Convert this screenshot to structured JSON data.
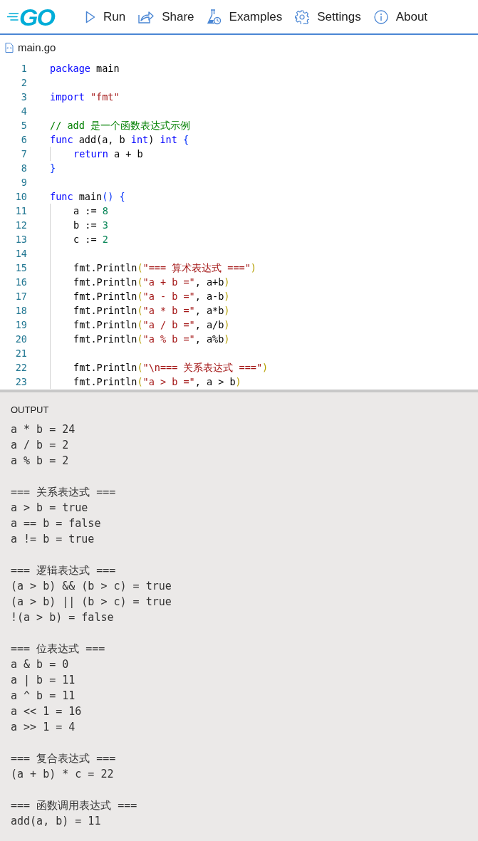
{
  "header": {
    "logo": "GO",
    "nav": [
      {
        "kind": "run",
        "label": "Run"
      },
      {
        "kind": "share",
        "label": "Share"
      },
      {
        "kind": "examples",
        "label": "Examples"
      },
      {
        "kind": "settings",
        "label": "Settings"
      },
      {
        "kind": "about",
        "label": "About"
      }
    ]
  },
  "file_tab": {
    "label": "main.go"
  },
  "editor": {
    "lines": [
      {
        "number": "1",
        "indented": false,
        "tokens": [
          {
            "kind": "keyword",
            "text": "package"
          },
          {
            "kind": "plain",
            "text": " main"
          }
        ]
      },
      {
        "number": "2",
        "indented": false
      },
      {
        "number": "3",
        "indented": false,
        "tokens": [
          {
            "kind": "keyword",
            "text": "import"
          },
          {
            "kind": "string",
            "text": " \"fmt\""
          }
        ]
      },
      {
        "number": "4",
        "indented": false
      },
      {
        "number": "5",
        "indented": false,
        "tokens": [
          {
            "kind": "comment",
            "text": "// add 是一个函数表达式示例"
          }
        ]
      },
      {
        "number": "6",
        "indented": false,
        "tokens": [
          {
            "kind": "keyword",
            "text": "func"
          },
          {
            "kind": "plain",
            "text": " add(a, b "
          },
          {
            "kind": "keyword",
            "text": "int"
          },
          {
            "kind": "plain",
            "text": ")"
          },
          {
            "kind": "keyword",
            "text": " int"
          },
          {
            "kind": "bracket",
            "text": " {"
          }
        ]
      },
      {
        "number": "7",
        "indented": true,
        "tokens": [
          {
            "kind": "keyword",
            "text": "return"
          },
          {
            "kind": "plain",
            "text": " a + b"
          }
        ]
      },
      {
        "number": "8",
        "indented": false,
        "tokens": [
          {
            "kind": "bracket",
            "text": "}"
          }
        ]
      },
      {
        "number": "9",
        "indented": false
      },
      {
        "number": "10",
        "indented": false,
        "tokens": [
          {
            "kind": "keyword",
            "text": "func"
          },
          {
            "kind": "plain",
            "text": " main"
          },
          {
            "kind": "bracket",
            "text": "() {"
          }
        ]
      },
      {
        "number": "11",
        "indented": true,
        "tokens": [
          {
            "kind": "plain",
            "text": "a :="
          },
          {
            "kind": "number",
            "text": " 8"
          }
        ]
      },
      {
        "number": "12",
        "indented": true,
        "tokens": [
          {
            "kind": "plain",
            "text": "b :="
          },
          {
            "kind": "number",
            "text": " 3"
          }
        ]
      },
      {
        "number": "13",
        "indented": true,
        "tokens": [
          {
            "kind": "plain",
            "text": "c :="
          },
          {
            "kind": "number",
            "text": " 2"
          }
        ]
      },
      {
        "number": "14",
        "indented": true
      },
      {
        "number": "15",
        "indented": true,
        "tokens": [
          {
            "kind": "plain",
            "text": "fmt.Println"
          },
          {
            "kind": "bracket2",
            "text": "("
          },
          {
            "kind": "string",
            "text": "\"=== 算术表达式 ===\""
          },
          {
            "kind": "bracket2",
            "text": ")"
          }
        ]
      },
      {
        "number": "16",
        "indented": true,
        "tokens": [
          {
            "kind": "plain",
            "text": "fmt.Println"
          },
          {
            "kind": "bracket2",
            "text": "("
          },
          {
            "kind": "string",
            "text": "\"a + b =\""
          },
          {
            "kind": "plain",
            "text": ", a+b"
          },
          {
            "kind": "bracket2",
            "text": ")"
          }
        ]
      },
      {
        "number": "17",
        "indented": true,
        "tokens": [
          {
            "kind": "plain",
            "text": "fmt.Println"
          },
          {
            "kind": "bracket2",
            "text": "("
          },
          {
            "kind": "string",
            "text": "\"a - b =\""
          },
          {
            "kind": "plain",
            "text": ", a-b"
          },
          {
            "kind": "bracket2",
            "text": ")"
          }
        ]
      },
      {
        "number": "18",
        "indented": true,
        "tokens": [
          {
            "kind": "plain",
            "text": "fmt.Println"
          },
          {
            "kind": "bracket2",
            "text": "("
          },
          {
            "kind": "string",
            "text": "\"a * b =\""
          },
          {
            "kind": "plain",
            "text": ", a*b"
          },
          {
            "kind": "bracket2",
            "text": ")"
          }
        ]
      },
      {
        "number": "19",
        "indented": true,
        "tokens": [
          {
            "kind": "plain",
            "text": "fmt.Println"
          },
          {
            "kind": "bracket2",
            "text": "("
          },
          {
            "kind": "string",
            "text": "\"a / b =\""
          },
          {
            "kind": "plain",
            "text": ", a/b"
          },
          {
            "kind": "bracket2",
            "text": ")"
          }
        ]
      },
      {
        "number": "20",
        "indented": true,
        "tokens": [
          {
            "kind": "plain",
            "text": "fmt.Println"
          },
          {
            "kind": "bracket2",
            "text": "("
          },
          {
            "kind": "string",
            "text": "\"a % b =\""
          },
          {
            "kind": "plain",
            "text": ", a%b"
          },
          {
            "kind": "bracket2",
            "text": ")"
          }
        ]
      },
      {
        "number": "21",
        "indented": true
      },
      {
        "number": "22",
        "indented": true,
        "tokens": [
          {
            "kind": "plain",
            "text": "fmt.Println"
          },
          {
            "kind": "bracket2",
            "text": "("
          },
          {
            "kind": "string",
            "text": "\"\\n=== 关系表达式 ===\""
          },
          {
            "kind": "bracket2",
            "text": ")"
          }
        ]
      },
      {
        "number": "23",
        "indented": true,
        "tokens": [
          {
            "kind": "plain",
            "text": "fmt.Println"
          },
          {
            "kind": "bracket2",
            "text": "("
          },
          {
            "kind": "string",
            "text": "\"a > b =\""
          },
          {
            "kind": "plain",
            "text": ", a > b"
          },
          {
            "kind": "bracket2",
            "text": ")"
          }
        ]
      }
    ]
  },
  "output": {
    "label": "OUTPUT",
    "blocks": [
      [
        "a * b = 24",
        "a / b = 2",
        "a % b = 2"
      ],
      [
        "=== 关系表达式 ===",
        "a > b = true",
        "a == b = false",
        "a != b = true"
      ],
      [
        "=== 逻辑表达式 ===",
        "(a > b) && (b > c) = true",
        "(a > b) || (b > c) = true",
        "!(a > b) = false"
      ],
      [
        "=== 位表达式 ===",
        "a & b = 0",
        "a | b = 11",
        "a ^ b = 11",
        "a << 1 = 16",
        "a >> 1 = 4"
      ],
      [
        "=== 复合表达式 ===",
        "(a + b) * c = 22"
      ],
      [
        "=== 函数调用表达式 ===",
        "add(a, b) = 11"
      ]
    ]
  }
}
